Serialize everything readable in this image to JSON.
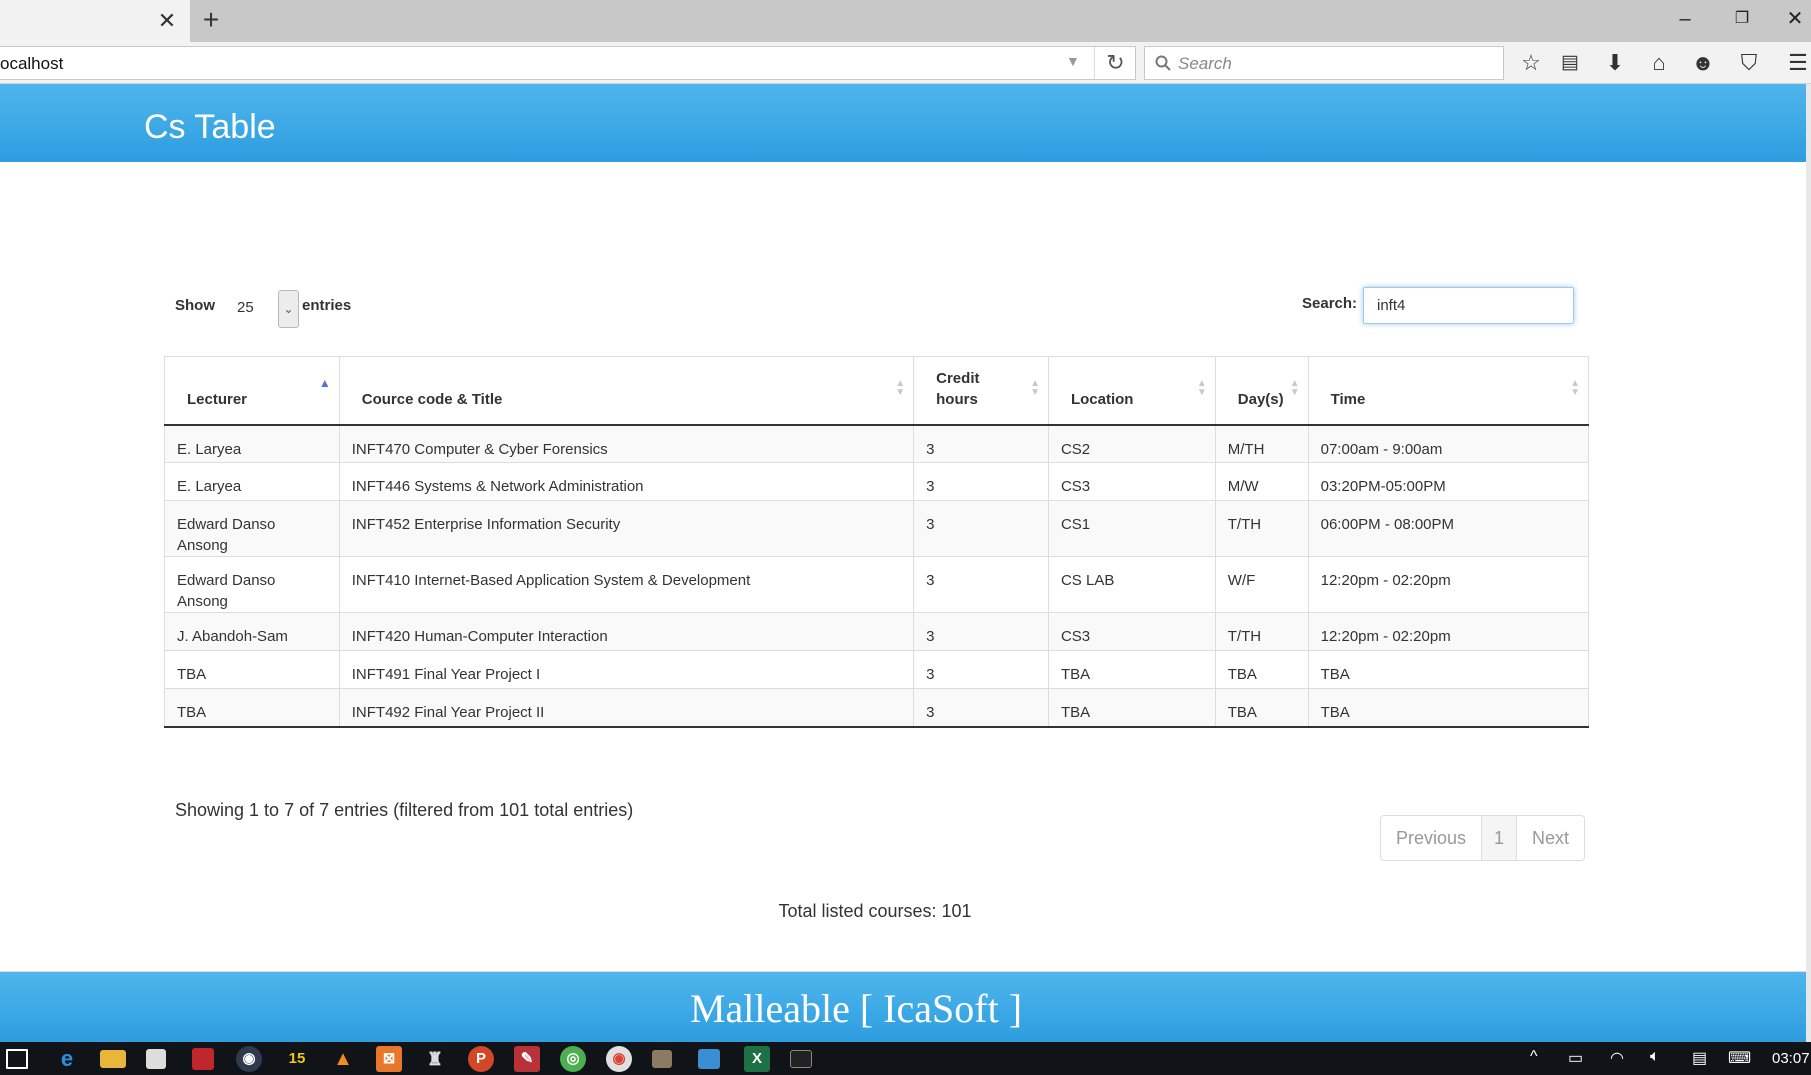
{
  "browser": {
    "url": "ocalhost",
    "search_placeholder": "Search"
  },
  "page": {
    "title": "Cs Table"
  },
  "controls": {
    "show_label": "Show",
    "entries_label": "entries",
    "page_length": "25",
    "search_label": "Search:",
    "search_value": "inft4"
  },
  "table": {
    "headers": [
      "Lecturer",
      "Cource code & Title",
      "Credit hours",
      "Location",
      "Day(s)",
      "Time"
    ],
    "rows": [
      [
        "E. Laryea",
        "INFT470 Computer & Cyber Forensics",
        "3",
        "CS2",
        "M/TH",
        "07:00am - 9:00am"
      ],
      [
        "E. Laryea",
        "INFT446 Systems & Network Administration",
        "3",
        "CS3",
        "M/W",
        "03:20PM-05:00PM"
      ],
      [
        "Edward Danso Ansong",
        "INFT452 Enterprise Information Security",
        "3",
        "CS1",
        "T/TH",
        "06:00PM - 08:00PM"
      ],
      [
        "Edward Danso Ansong",
        "INFT410 Internet-Based Application System & Development",
        "3",
        "CS LAB",
        "W/F",
        "12:20pm - 02:20pm"
      ],
      [
        "J. Abandoh-Sam",
        "INFT420 Human-Computer Interaction",
        "3",
        "CS3",
        "T/TH",
        "12:20pm - 02:20pm"
      ],
      [
        "TBA",
        "INFT491 Final Year Project I",
        "3",
        "TBA",
        "TBA",
        "TBA"
      ],
      [
        "TBA",
        "INFT492 Final Year Project II",
        "3",
        "TBA",
        "TBA",
        "TBA"
      ]
    ]
  },
  "info": "Showing 1 to 7 of 7 entries (filtered from 101 total entries)",
  "pagination": {
    "previous": "Previous",
    "current": "1",
    "next": "Next"
  },
  "total_text": "Total listed courses: 101",
  "footer": "Malleable [ IcaSoft ]",
  "taskbar": {
    "time": "03:07"
  }
}
